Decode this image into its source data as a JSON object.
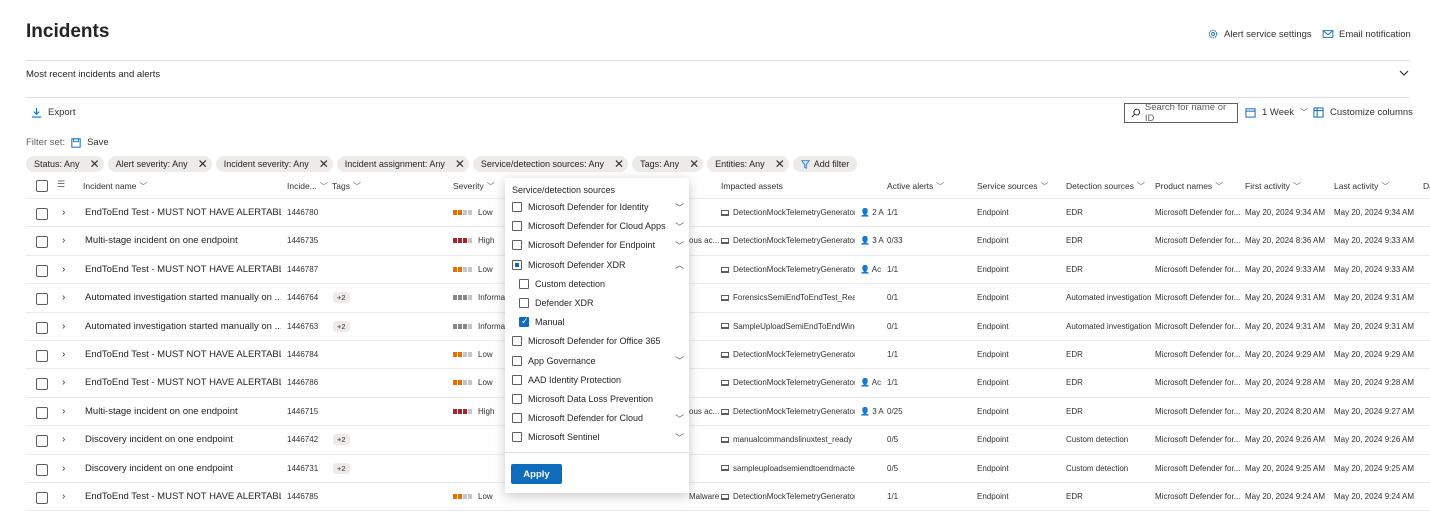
{
  "page": {
    "title": "Incidents"
  },
  "header_links": {
    "alert_settings": "Alert service settings",
    "email_notification": "Email notification"
  },
  "recent": {
    "label": "Most recent incidents and alerts"
  },
  "toolbar": {
    "export": "Export",
    "search_placeholder": "Search for name or ID",
    "time_range": "1 Week",
    "customize_columns": "Customize columns"
  },
  "filter_set": {
    "label": "Filter set:",
    "save": "Save"
  },
  "filters": [
    "Status: Any",
    "Alert severity: Any",
    "Incident severity: Any",
    "Incident assignment: Any",
    "Service/detection sources: Any",
    "Tags: Any",
    "Entities: Any"
  ],
  "add_filter": "Add filter",
  "columns": {
    "incident_name": "Incident name",
    "incident_id": "Incide...",
    "tags": "Tags",
    "severity": "Severity",
    "impacted_assets": "Impacted assets",
    "active_alerts": "Active alerts",
    "service_sources": "Service sources",
    "detection_sources": "Detection sources",
    "product_names": "Product names",
    "first_activity": "First activity",
    "last_activity": "Last activity",
    "trailing": "Da"
  },
  "rows": [
    {
      "name": "EndToEnd Test - MUST NOT HAVE ALERTABLE ...",
      "id": "1446780",
      "tags": "",
      "severity": "Low",
      "category": "",
      "asset": "DetectionMockTelemetryGenerator",
      "user": "2 A",
      "alerts": "1/1",
      "service": "Endpoint",
      "detection": "EDR",
      "product": "Microsoft Defender for...",
      "first": "May 20, 2024 9:34 AM",
      "last": "May 20, 2024 9:34 AM"
    },
    {
      "name": "Multi-stage incident on one endpoint",
      "id": "1446735",
      "tags": "",
      "severity": "High",
      "category": "ous ac...",
      "asset": "DetectionMockTelemetryGenerator",
      "user": "3 A",
      "alerts": "0/33",
      "service": "Endpoint",
      "detection": "EDR",
      "product": "Microsoft Defender for...",
      "first": "May 20, 2024 8:36 AM",
      "last": "May 20, 2024 9:33 AM"
    },
    {
      "name": "EndToEnd Test - MUST NOT HAVE ALERTABLE ...",
      "id": "1446787",
      "tags": "",
      "severity": "Low",
      "category": "",
      "asset": "DetectionMockTelemetryGenerator",
      "user": "Ac",
      "alerts": "1/1",
      "service": "Endpoint",
      "detection": "EDR",
      "product": "Microsoft Defender for...",
      "first": "May 20, 2024 9:33 AM",
      "last": "May 20, 2024 9:33 AM"
    },
    {
      "name": "Automated investigation started manually on ...",
      "id": "1446764",
      "tags": "+2",
      "severity": "Informat",
      "category": "",
      "asset": "ForensicsSemiEndToEndTest_Ready",
      "user": "",
      "alerts": "0/1",
      "service": "Endpoint",
      "detection": "Automated investigation",
      "product": "Microsoft Defender for...",
      "first": "May 20, 2024 9:31 AM",
      "last": "May 20, 2024 9:31 AM"
    },
    {
      "name": "Automated investigation started manually on ...",
      "id": "1446763",
      "tags": "+2",
      "severity": "Informat",
      "category": "",
      "asset": "SampleUploadSemiEndToEndWindowTest_R",
      "user": "",
      "alerts": "0/1",
      "service": "Endpoint",
      "detection": "Automated investigation",
      "product": "Microsoft Defender for...",
      "first": "May 20, 2024 9:31 AM",
      "last": "May 20, 2024 9:31 AM"
    },
    {
      "name": "EndToEnd Test - MUST NOT HAVE ALERTABLE ...",
      "id": "1446784",
      "tags": "",
      "severity": "Low",
      "category": "",
      "asset": "DetectionMockTelemetryGenerator",
      "user": "",
      "alerts": "1/1",
      "service": "Endpoint",
      "detection": "EDR",
      "product": "Microsoft Defender for...",
      "first": "May 20, 2024 9:29 AM",
      "last": "May 20, 2024 9:29 AM"
    },
    {
      "name": "EndToEnd Test - MUST NOT HAVE ALERTABLE ...",
      "id": "1446786",
      "tags": "",
      "severity": "Low",
      "category": "",
      "asset": "DetectionMockTelemetryGenerator",
      "user": "Ac",
      "alerts": "1/1",
      "service": "Endpoint",
      "detection": "EDR",
      "product": "Microsoft Defender for...",
      "first": "May 20, 2024 9:28 AM",
      "last": "May 20, 2024 9:28 AM"
    },
    {
      "name": "Multi-stage incident on one endpoint",
      "id": "1446715",
      "tags": "",
      "severity": "High",
      "category": "ous ac...",
      "asset": "DetectionMockTelemetryGenerator",
      "user": "3 A",
      "alerts": "0/25",
      "service": "Endpoint",
      "detection": "EDR",
      "product": "Microsoft Defender for...",
      "first": "May 20, 2024 8:20 AM",
      "last": "May 20, 2024 9:27 AM"
    },
    {
      "name": "Discovery incident on one endpoint",
      "id": "1446742",
      "tags": "+2",
      "severity": "",
      "category": "",
      "asset": "manualcommandslinuxtest_ready",
      "user": "",
      "alerts": "0/5",
      "service": "Endpoint",
      "detection": "Custom detection",
      "product": "Microsoft Defender for...",
      "first": "May 20, 2024 9:26 AM",
      "last": "May 20, 2024 9:26 AM"
    },
    {
      "name": "Discovery incident on one endpoint",
      "id": "1446731",
      "tags": "+2",
      "severity": "",
      "category": "",
      "asset": "sampleuploadsemiendtoendmactest_ready",
      "user": "",
      "alerts": "0/5",
      "service": "Endpoint",
      "detection": "Custom detection",
      "product": "Microsoft Defender for...",
      "first": "May 20, 2024 9:25 AM",
      "last": "May 20, 2024 9:25 AM"
    },
    {
      "name": "EndToEnd Test - MUST NOT HAVE ALERTABLE ...",
      "id": "1446785",
      "tags": "",
      "severity": "Low",
      "category": "Malware",
      "asset": "DetectionMockTelemetryGenerator",
      "user": "",
      "alerts": "1/1",
      "service": "Endpoint",
      "detection": "EDR",
      "product": "Microsoft Defender for...",
      "first": "May 20, 2024 9:24 AM",
      "last": "May 20, 2024 9:24 AM"
    }
  ],
  "dropdown": {
    "title": "Service/detection sources",
    "items": [
      {
        "label": "Microsoft Defender for Identity",
        "state": "none",
        "caret": "down",
        "child": false
      },
      {
        "label": "Microsoft Defender for Cloud Apps",
        "state": "none",
        "caret": "down",
        "child": false
      },
      {
        "label": "Microsoft Defender for Endpoint",
        "state": "none",
        "caret": "down",
        "child": false
      },
      {
        "label": "Microsoft Defender XDR",
        "state": "partial",
        "caret": "up",
        "child": false
      },
      {
        "label": "Custom detection",
        "state": "none",
        "caret": "",
        "child": true
      },
      {
        "label": "Defender XDR",
        "state": "none",
        "caret": "",
        "child": true
      },
      {
        "label": "Manual",
        "state": "checked",
        "caret": "",
        "child": true
      },
      {
        "label": "Microsoft Defender for Office 365",
        "state": "none",
        "caret": "",
        "child": false
      },
      {
        "label": "App Governance",
        "state": "none",
        "caret": "down",
        "child": false
      },
      {
        "label": "AAD Identity Protection",
        "state": "none",
        "caret": "",
        "child": false
      },
      {
        "label": "Microsoft Data Loss Prevention",
        "state": "none",
        "caret": "",
        "child": false
      },
      {
        "label": "Microsoft Defender for Cloud",
        "state": "none",
        "caret": "down",
        "child": false
      },
      {
        "label": "Microsoft Sentinel",
        "state": "none",
        "caret": "down",
        "child": false
      }
    ],
    "apply": "Apply"
  },
  "colors": {
    "accent": "#0f6cbd",
    "sev_low": "#e86e00",
    "sev_high": "#a4262c",
    "sev_info": "#8a8886",
    "sev_off": "#c8c6c4"
  }
}
